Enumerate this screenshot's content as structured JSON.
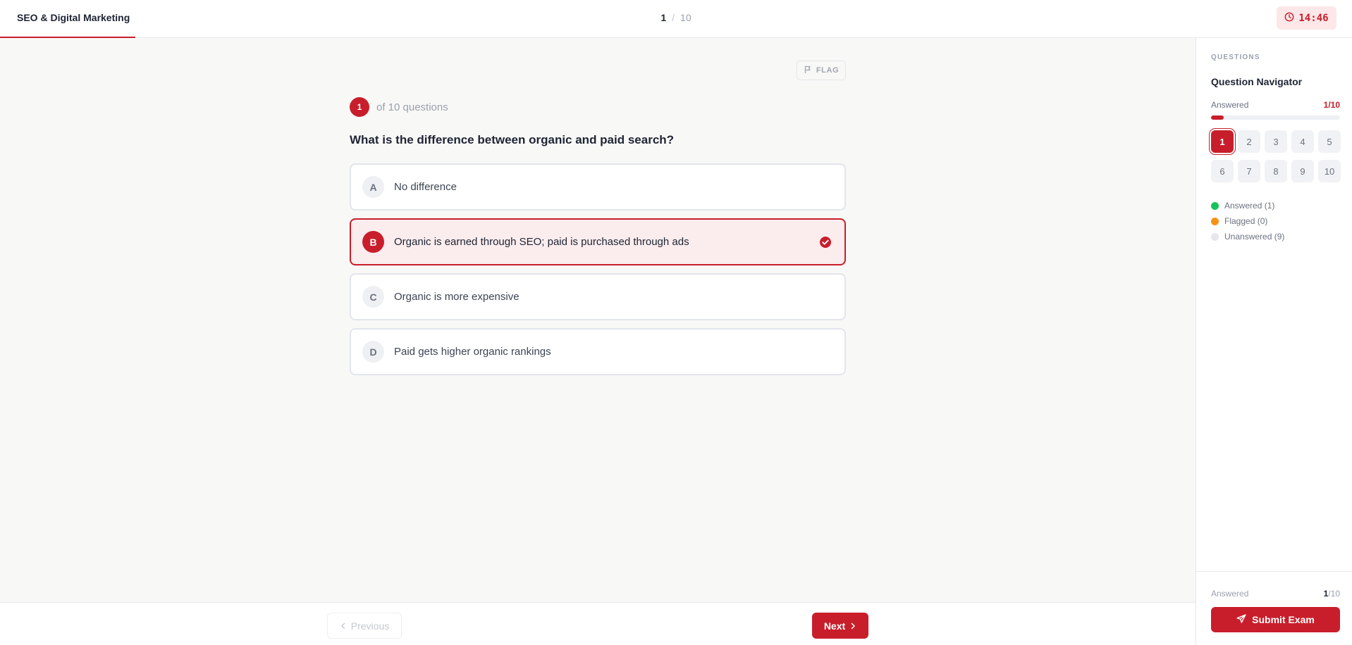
{
  "header": {
    "exam_title": "SEO & Digital Marketing",
    "current_question": "1",
    "separator": "/",
    "total_questions": "10",
    "timer": "14:46"
  },
  "question": {
    "flag_label": "FLAG",
    "number": "1",
    "of_text": "of 10 questions",
    "text": "What is the difference between organic and paid search?",
    "options": [
      {
        "letter": "A",
        "text": "No difference",
        "selected": false
      },
      {
        "letter": "B",
        "text": "Organic is earned through SEO; paid is purchased through ads",
        "selected": true
      },
      {
        "letter": "C",
        "text": "Organic is more expensive",
        "selected": false
      },
      {
        "letter": "D",
        "text": "Paid gets higher organic rankings",
        "selected": false
      }
    ]
  },
  "footer_nav": {
    "previous_label": "Previous",
    "next_label": "Next"
  },
  "sidebar": {
    "kicker": "QUESTIONS",
    "title": "Question Navigator",
    "answered_label": "Answered",
    "answered_value": "1/10",
    "progress_fraction": 0.1,
    "questions": [
      "1",
      "2",
      "3",
      "4",
      "5",
      "6",
      "7",
      "8",
      "9",
      "10"
    ],
    "current": "1",
    "legend": [
      {
        "label": "Answered (1)",
        "color": "#16c35a"
      },
      {
        "label": "Flagged (0)",
        "color": "#f59316"
      },
      {
        "label": "Unanswered (9)",
        "color": "#e5e7ec"
      }
    ],
    "footer_answered_label": "Answered",
    "footer_answered_count": "1",
    "footer_answered_total": "/10",
    "submit_label": "Submit Exam"
  },
  "colors": {
    "accent": "#c81e2b",
    "accent_soft": "#fbeced",
    "timer_bg": "#fde7e8"
  }
}
